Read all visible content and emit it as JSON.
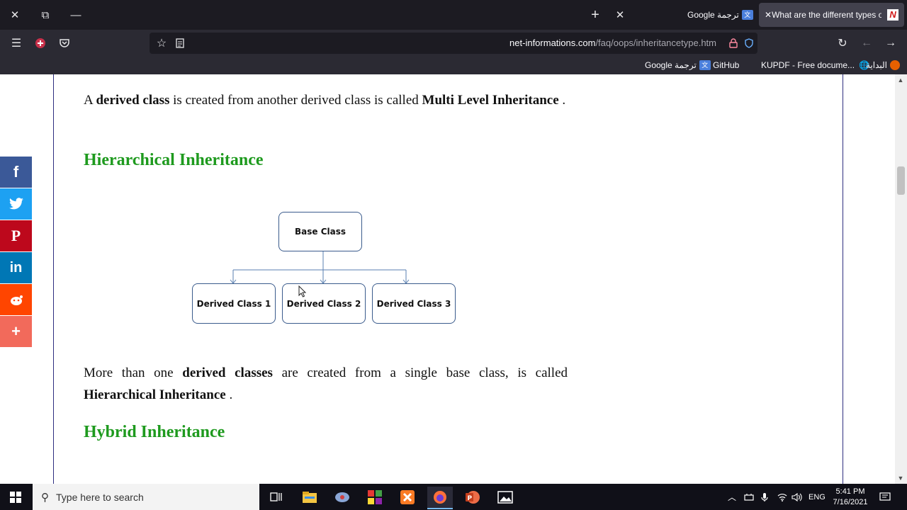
{
  "browser": {
    "tabs": [
      {
        "label": "Google ترجمة",
        "icon": "google-translate-icon"
      },
      {
        "label": "What are the different types of i",
        "icon": "net-informations-icon",
        "active": true
      }
    ],
    "url_domain": "net-informations.com",
    "url_path": "/faq/oops/inheritancetype.htm",
    "bookmarks": [
      {
        "label": "Google ترجمة",
        "icon": "google-translate-icon"
      },
      {
        "label": "GitHub",
        "icon": ""
      },
      {
        "label": "KUPDF - Free docume...",
        "icon": "globe-icon"
      },
      {
        "label": "البداية",
        "icon": "firefox-icon"
      }
    ]
  },
  "article": {
    "para1_a": "A",
    "para1_b": "derived class",
    "para1_c": "is created from another derived class is called",
    "para1_d": "Multi Level Inheritance",
    "para1_e": ".",
    "heading1": "Hierarchical Inheritance",
    "diagram": {
      "base": "Base Class",
      "children": [
        "Derived Class 1",
        "Derived Class 2",
        "Derived Class 3"
      ]
    },
    "para2_a": "More than one",
    "para2_b": "derived classes",
    "para2_c": "are created from a single base class, is called",
    "para2_d": "Hierarchical Inheritance",
    "para2_e": ".",
    "heading2": "Hybrid Inheritance"
  },
  "social": [
    {
      "name": "facebook",
      "glyph": "f",
      "color": "#3b5998"
    },
    {
      "name": "twitter",
      "glyph": "t",
      "color": "#1da1f2"
    },
    {
      "name": "pinterest",
      "glyph": "P",
      "color": "#bd081c"
    },
    {
      "name": "linkedin",
      "glyph": "in",
      "color": "#0077b5"
    },
    {
      "name": "reddit",
      "glyph": "r",
      "color": "#ff4500"
    },
    {
      "name": "more",
      "glyph": "+",
      "color": "#f26a5b"
    }
  ],
  "taskbar": {
    "search_placeholder": "Type here to search",
    "language": "ENG",
    "time": "5:41 PM",
    "date": "7/16/2021"
  }
}
